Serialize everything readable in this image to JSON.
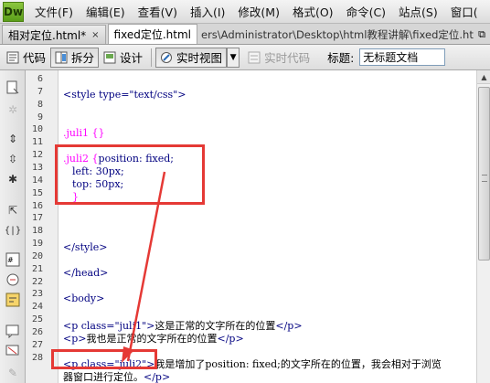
{
  "app": {
    "logo": "Dw",
    "menu": [
      "文件(F)",
      "编辑(E)",
      "查看(V)",
      "插入(I)",
      "修改(M)",
      "格式(O)",
      "命令(C)",
      "站点(S)",
      "窗口("
    ]
  },
  "tabs": [
    {
      "label": "相对定位.html*",
      "close": "×"
    },
    {
      "label": "fixed定位.html",
      "close": ""
    }
  ],
  "filepath": "ers\\Administrator\\Desktop\\html教程讲解\\fixed定位.html",
  "toolbar": {
    "code": "代码",
    "split": "拆分",
    "design": "设计",
    "live_view": "实时视图",
    "live_code": "实时代码",
    "title_label": "标题:",
    "title_value": "无标题文档"
  },
  "lines": [
    {
      "n": "6"
    },
    {
      "n": "7"
    },
    {
      "n": "8"
    },
    {
      "n": "9"
    },
    {
      "n": "10"
    },
    {
      "n": "11"
    },
    {
      "n": "12"
    },
    {
      "n": "13"
    },
    {
      "n": "14"
    },
    {
      "n": "15"
    },
    {
      "n": "16"
    },
    {
      "n": "17"
    },
    {
      "n": "18"
    },
    {
      "n": "19"
    },
    {
      "n": "20"
    },
    {
      "n": "21"
    },
    {
      "n": "22"
    },
    {
      "n": "23"
    },
    {
      "n": "24"
    },
    {
      "n": "25"
    },
    {
      "n": "26"
    },
    {
      "n": "27"
    },
    {
      "n": "28"
    }
  ],
  "code": {
    "style_open": "<style type=\"text/css\">",
    "juli1": ".juli1 {}",
    "juli2_sel": ".juli2 {",
    "juli2_pos": "position: fixed;",
    "left": "left: 30px;",
    "top": "top: 50px;",
    "close_brace": "}",
    "style_close": "</style>",
    "head_close": "</head>",
    "body_open": "<body>",
    "p1_tag": "<p class=\"juli1\">",
    "p1_text": "这是正常的文字所在的位置",
    "p_close": "</p>",
    "p2_tag": "<p>",
    "p2_text": "我也是正常的文字所在的位置",
    "p3_tag": "<p class=\"juli2\">",
    "p3_text": "我是增加了position: fixed;的文字所在的位置，我会相对于浏览",
    "p3_cont": "器窗口进行定位。"
  },
  "colors": {
    "highlight": "#e53935"
  }
}
